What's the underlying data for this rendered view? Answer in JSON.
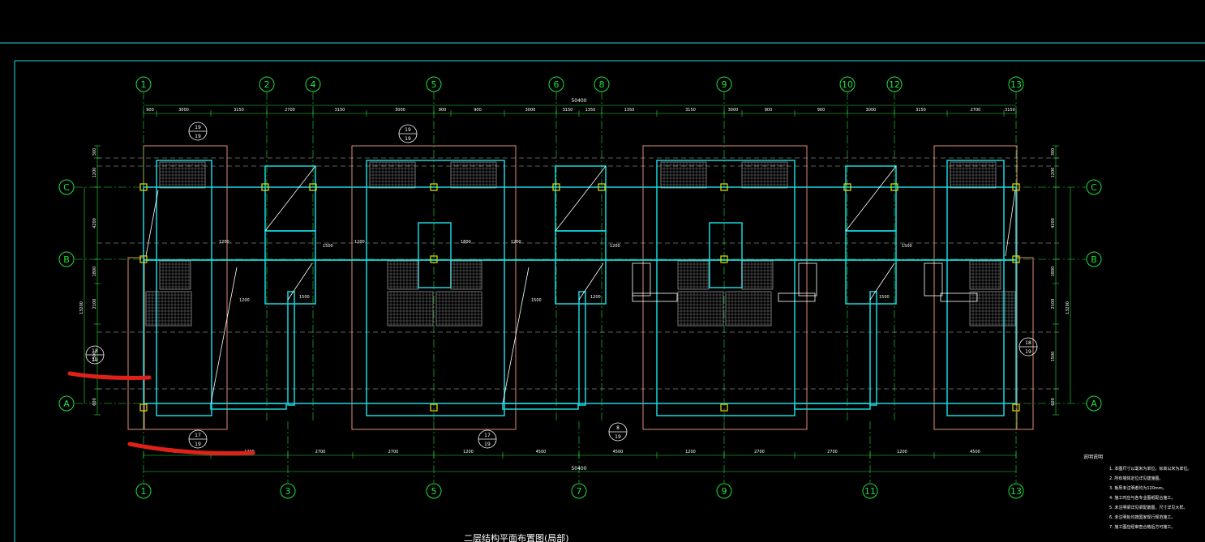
{
  "drawing": {
    "title": "",
    "colors": {
      "background": "#000000",
      "frame": "#18d8e0",
      "axis": "#20e040",
      "dim": "#20e040",
      "wall": "#18d8e0",
      "foundation": "#e09070",
      "dash": "#c0c0c0",
      "white": "#ffffff",
      "yellow": "#e8e000",
      "hatch": "#c0c0c0",
      "annotation_red": "#e0201a"
    },
    "top_axes": [
      "1",
      "2",
      "4",
      "5",
      "6",
      "8",
      "9",
      "10",
      "12",
      "13"
    ],
    "bottom_axes": [
      "1",
      "3",
      "5",
      "7",
      "9",
      "11",
      "13"
    ],
    "side_axes": [
      "C",
      "B",
      "A"
    ],
    "top_total": "50400",
    "bottom_total": "50400",
    "top_segments": [
      "900",
      "3000",
      "3150",
      "2700",
      "3150",
      "3000",
      "900",
      "900",
      "3000",
      "3150",
      "1350",
      "1350",
      "3150",
      "3000",
      "900",
      "900",
      "3000",
      "3150",
      "2700",
      "3150",
      "3000",
      "900"
    ],
    "bottom_segments": [
      "4500",
      "1200",
      "2700",
      "2700",
      "1200",
      "4500",
      "4500",
      "1200",
      "2700",
      "2700",
      "1200",
      "4500",
      "1200",
      "2700"
    ],
    "left_outer": "13200",
    "left_segments": [
      "300",
      "1200",
      "4200",
      "1800",
      "2100",
      "1500",
      "600"
    ],
    "right_outer": "13200",
    "right_segments": [
      "300",
      "1200",
      "4200",
      "1800",
      "2100",
      "1500",
      "600"
    ],
    "interior_dims": [
      "1200",
      "1200",
      "1500",
      "1800",
      "1200",
      "1200",
      "1500",
      "1200",
      "1500",
      "1500",
      "1200",
      "1500"
    ],
    "detail_refs": [
      {
        "num": "19",
        "sheet": "19"
      },
      {
        "num": "19",
        "sheet": "19"
      },
      {
        "num": "18",
        "sheet": "19"
      },
      {
        "num": "17",
        "sheet": "19"
      },
      {
        "num": "17",
        "sheet": "19"
      },
      {
        "num": "8",
        "sheet": "19"
      },
      {
        "num": "18",
        "sheet": "19"
      }
    ],
    "notes": {
      "heading": "说明说明",
      "lines": [
        "1. 本图尺寸以毫米为单位，标高以米为单位。",
        "2. 所有墙体定位详见建施图。",
        "3. 板厚未注明者均为120mm。",
        "4. 施工时应与各专业图纸配合施工。",
        "5. 未注明梁详见梁配筋图，尺寸详见大样。",
        "6. 未注明处均按国家现行规范施工。",
        "7. 施工图应经审查合格后方可施工。"
      ]
    },
    "bottom_caption": "二层结构平面布置图(局部)"
  }
}
